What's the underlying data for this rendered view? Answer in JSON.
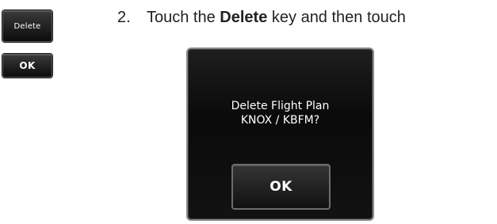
{
  "keys": {
    "delete_label": "Delete",
    "ok_label": "OK"
  },
  "step": {
    "number": "2.",
    "text_before": "Touch the ",
    "bold_word": "Delete",
    "text_after": " key and then touch"
  },
  "dialog": {
    "line1": "Delete Flight Plan",
    "line2": "KNOX / KBFM?",
    "ok_label": "OK"
  },
  "colors": {
    "key_background": "#1a1a1a",
    "dialog_background": "#111111",
    "text_light": "#ffffff",
    "text_dark": "#222222"
  }
}
